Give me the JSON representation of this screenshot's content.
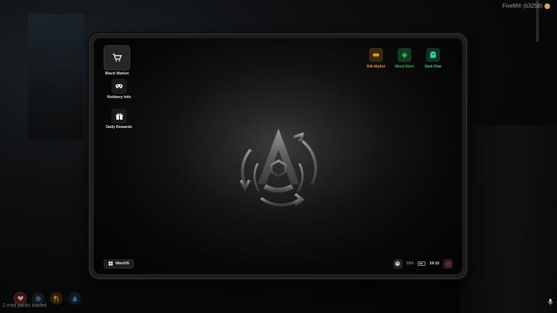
{
  "overlay": {
    "server_label": "FiveM® (b3258)",
    "mod_packs": "2 mod packs loaded"
  },
  "desktop_icons": [
    {
      "label": "Black Market",
      "icon": "cart-icon"
    },
    {
      "label": "Robbery Info",
      "icon": "mask-icon"
    },
    {
      "label": "Daily Rewards",
      "icon": "gift-icon"
    }
  ],
  "apps": [
    {
      "label": "Silk Market",
      "icon": "silk-icon",
      "color": "#f59e0b"
    },
    {
      "label": "Weed Store",
      "icon": "leaf-icon",
      "color": "#22c55e"
    },
    {
      "label": "Dark Chat",
      "icon": "ghost-icon",
      "color": "#34d399"
    }
  ],
  "taskbar": {
    "start_label": "WenOS",
    "battery_percent": "53%",
    "battery_level": 0.53,
    "clock": "19:12"
  },
  "colors": {
    "power": "#ef4444",
    "battery": "#22c55e"
  }
}
